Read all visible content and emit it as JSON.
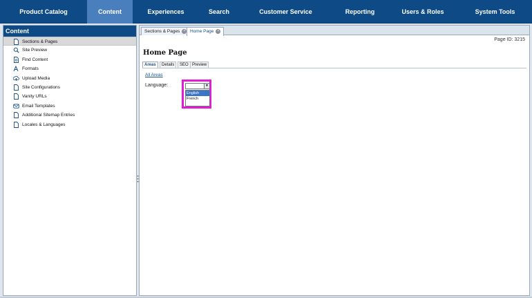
{
  "nav": {
    "tabs": [
      {
        "label": "Product Catalog"
      },
      {
        "label": "Content"
      },
      {
        "label": "Experiences"
      },
      {
        "label": "Search"
      },
      {
        "label": "Customer Service"
      },
      {
        "label": "Reporting"
      },
      {
        "label": "Users & Roles"
      },
      {
        "label": "System Tools"
      }
    ],
    "active": "Content"
  },
  "sidebar": {
    "title": "Content",
    "items": [
      {
        "label": "Sections & Pages",
        "icon": "document-icon"
      },
      {
        "label": "Site Preview",
        "icon": "magnifier-icon"
      },
      {
        "label": "Find Content",
        "icon": "find-document-icon"
      },
      {
        "label": "Formats",
        "icon": "font-icon"
      },
      {
        "label": "Upload Media",
        "icon": "upload-cloud-icon"
      },
      {
        "label": "Site Configurations",
        "icon": "document-icon"
      },
      {
        "label": "Vanity URLs",
        "icon": "document-icon"
      },
      {
        "label": "Email Templates",
        "icon": "envelope-icon"
      },
      {
        "label": "Additional Sitemap Entries",
        "icon": "document-icon"
      },
      {
        "label": "Locales & Languages",
        "icon": "document-icon"
      }
    ],
    "selected": "Sections & Pages"
  },
  "doc_tabs": [
    {
      "label": "Sections & Pages"
    },
    {
      "label": "Home Page"
    }
  ],
  "page": {
    "id_text": "Page ID: 3215",
    "title": "Home Page",
    "subtabs": [
      {
        "label": "Areas"
      },
      {
        "label": "Details"
      },
      {
        "label": "SEO"
      },
      {
        "label": "Preview"
      }
    ],
    "all_areas_link": "All Areas",
    "language_label": "Language:",
    "language_value": "",
    "language_options": [
      "English",
      "French"
    ],
    "highlighted_option": "English"
  },
  "colors": {
    "nav_bg": "#0e4a86",
    "nav_active": "#4a7fbd",
    "highlight_border": "#e31bd5",
    "link": "#1a4f8a"
  }
}
